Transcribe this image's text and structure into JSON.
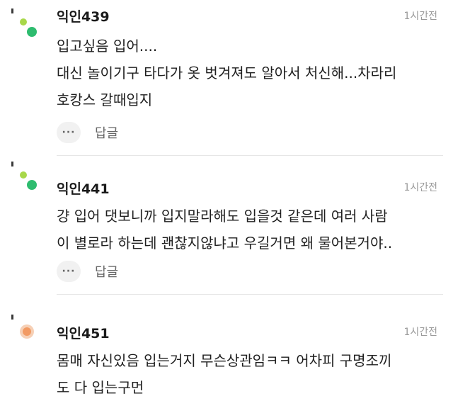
{
  "comments": [
    {
      "author": "익인439",
      "time": "1시간전",
      "lines": [
        "입고싶음 입어....",
        "대신 놀이기구 타다가 옷 벗겨져도 알아서 처신해...차라리",
        "호캉스 갈때입지"
      ],
      "more_label": "···",
      "reply_label": "답글",
      "avatar_icon": "green-dots-avatar-icon"
    },
    {
      "author": "익인441",
      "time": "1시간전",
      "lines": [
        "걍 입어 댓보니까 입지말라해도 입을것 같은데 여러 사람",
        "이 별로라 하는데 괜찮지않냐고 우길거면 왜 물어본거야.."
      ],
      "more_label": "···",
      "reply_label": "답글",
      "avatar_icon": "green-dots-avatar-icon"
    },
    {
      "author": "익인451",
      "time": "1시간전",
      "lines": [
        "몸매 자신있음 입는거지 무슨상관임ㅋㅋ 어차피 구명조끼",
        "도 다 입는구먼"
      ],
      "avatar_icon": "orange-circle-avatar-icon"
    }
  ]
}
